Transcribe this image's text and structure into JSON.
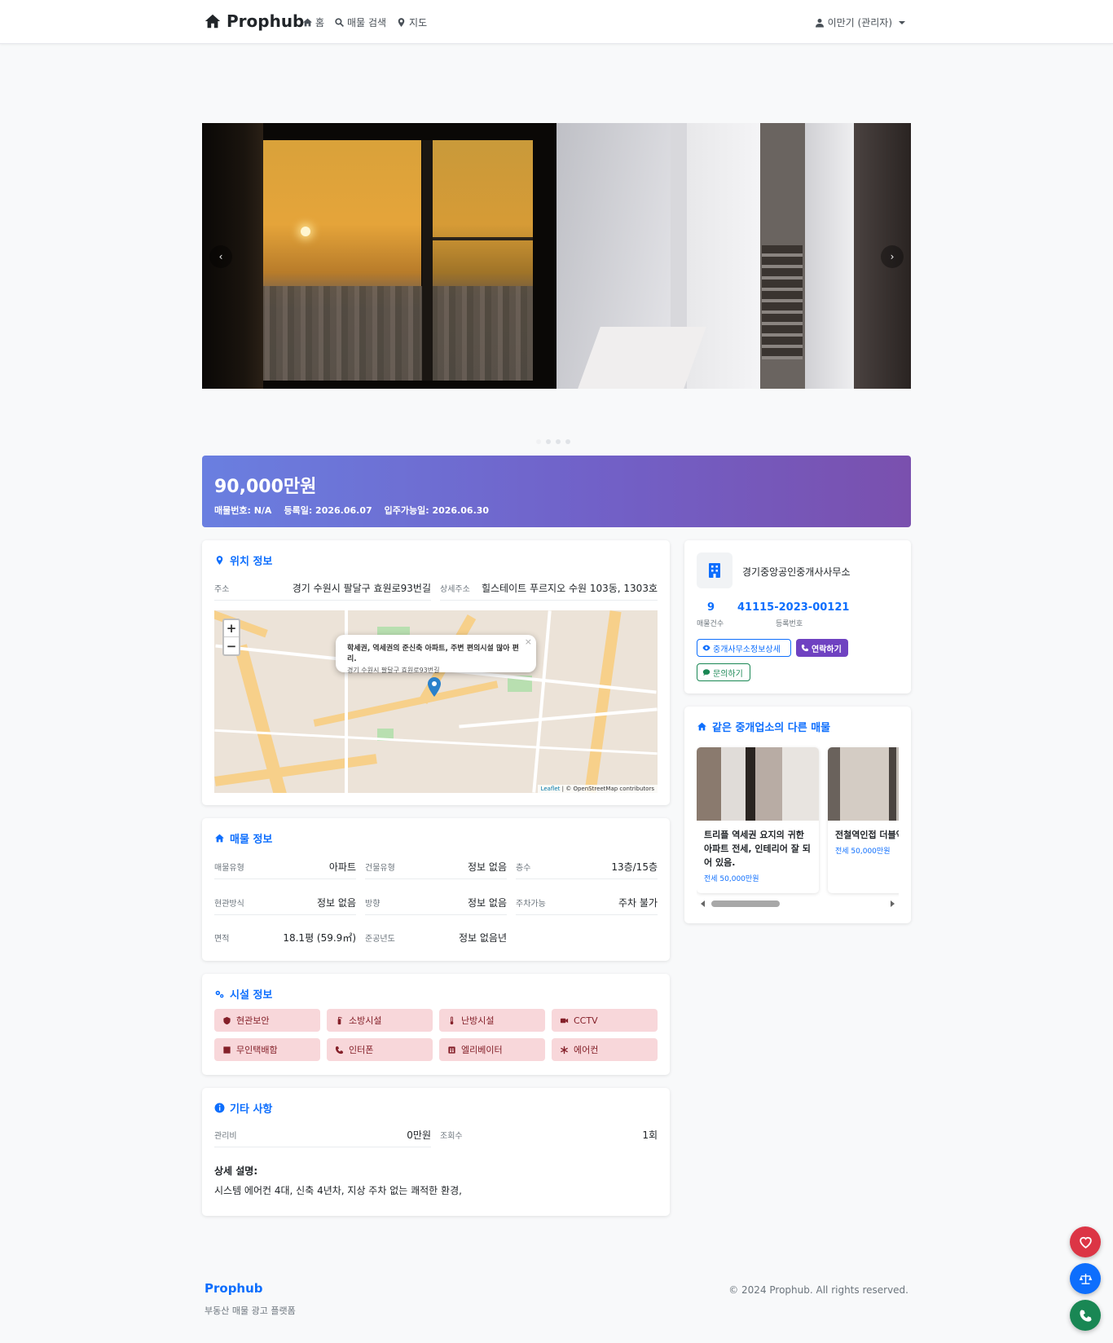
{
  "nav": {
    "brand": "Prophub",
    "links": [
      {
        "label": "홈",
        "icon": "home-icon"
      },
      {
        "label": "매물 검색",
        "icon": "search-icon"
      },
      {
        "label": "지도",
        "icon": "map-marker-icon"
      }
    ],
    "user": "이만기 (관리자)"
  },
  "carousel": {
    "prev": "‹",
    "next": "›",
    "slides": 4
  },
  "price": {
    "amount": "90,000만원",
    "listing_no": "매물번호: N/A",
    "registered": "등록일: 2026.06.07",
    "move_in": "입주가능일: 2026.06.30"
  },
  "location": {
    "title": "위치 정보",
    "address_label": "주소",
    "address": "경기 수원시 팔달구 효원로93번길",
    "detail_label": "상세주소",
    "detail": "힐스테이트 푸르지오 수원 103동, 1303호",
    "popup_title": "학세권, 역세권의 준신축 아파트, 주변 편의시설 많아 편리.",
    "popup_address": "경기 수원시 팔달구 효원로93번길",
    "attribution_link": "Leaflet",
    "attribution": " | © OpenStreetMap contributors"
  },
  "property": {
    "title": "매물 정보",
    "rows": [
      [
        {
          "k": "매물유형",
          "v": "아파트"
        },
        {
          "k": "건물유형",
          "v": "정보 없음"
        },
        {
          "k": "층수",
          "v": "13층/15층"
        }
      ],
      [
        {
          "k": "현관방식",
          "v": "정보 없음"
        },
        {
          "k": "방향",
          "v": "정보 없음"
        },
        {
          "k": "주차가능",
          "v": "주차 불가"
        }
      ],
      [
        {
          "k": "면적",
          "v": "18.1평 (59.9㎡)"
        },
        {
          "k": "준공년도",
          "v": "정보 없음년"
        }
      ]
    ]
  },
  "facilities": {
    "title": "시설 정보",
    "items": [
      {
        "label": "현관보안",
        "icon": "shield-icon"
      },
      {
        "label": "소방시설",
        "icon": "fire-extinguisher-icon"
      },
      {
        "label": "난방시설",
        "icon": "thermometer-icon"
      },
      {
        "label": "CCTV",
        "icon": "video-camera-icon"
      },
      {
        "label": "무인택배함",
        "icon": "box-icon"
      },
      {
        "label": "인터폰",
        "icon": "phone-icon"
      },
      {
        "label": "엘리베이터",
        "icon": "elevator-icon"
      },
      {
        "label": "에어컨",
        "icon": "snowflake-icon"
      }
    ],
    "badge_bg": "#f8d7da",
    "badge_fg": "#842029"
  },
  "other": {
    "title": "기타 사항",
    "fee_label": "관리비",
    "fee": "0만원",
    "views_label": "조회수",
    "views": "1회",
    "desc_label": "상세 설명:",
    "desc": "시스템 에어컨 4대, 신축 4년차, 지상 주차 없는 쾌적한 환경,"
  },
  "agent": {
    "name": "경기중앙공인중개사사무소",
    "listing_count": "9",
    "listing_count_label": "매물건수",
    "reg_no": "41115-2023-00121",
    "reg_no_label": "등록번호",
    "detail_btn": "중개사무소정보상세",
    "contact_btn": "연락하기",
    "inquiry_btn": "문의하기"
  },
  "related": {
    "title": "같은 중개업소의 다른 매물",
    "items": [
      {
        "title": "트리플 역세권 요지의 귀한 아파트 전세, 인테리어 잘 되어 있음.",
        "price": "전세 50,000만원"
      },
      {
        "title": "전철역인접 더블역",
        "price": "전세 50,000만원"
      }
    ]
  },
  "footer": {
    "brand": "Prophub",
    "tagline": "부동산 매물 광고 플랫폼",
    "copyright": "© 2024 Prophub. All rights reserved."
  },
  "fabs": [
    {
      "icon": "heart-icon",
      "color": "#dc3545"
    },
    {
      "icon": "scale-icon",
      "color": "#0d6efd"
    },
    {
      "icon": "phone-icon",
      "color": "#198754"
    }
  ],
  "colors": {
    "accent": "#0d6efd",
    "price_gradient_start": "#6a7fe0",
    "price_gradient_end": "#7a50ae",
    "contact_button": "#6f42c1",
    "inquiry_button": "#198754"
  }
}
